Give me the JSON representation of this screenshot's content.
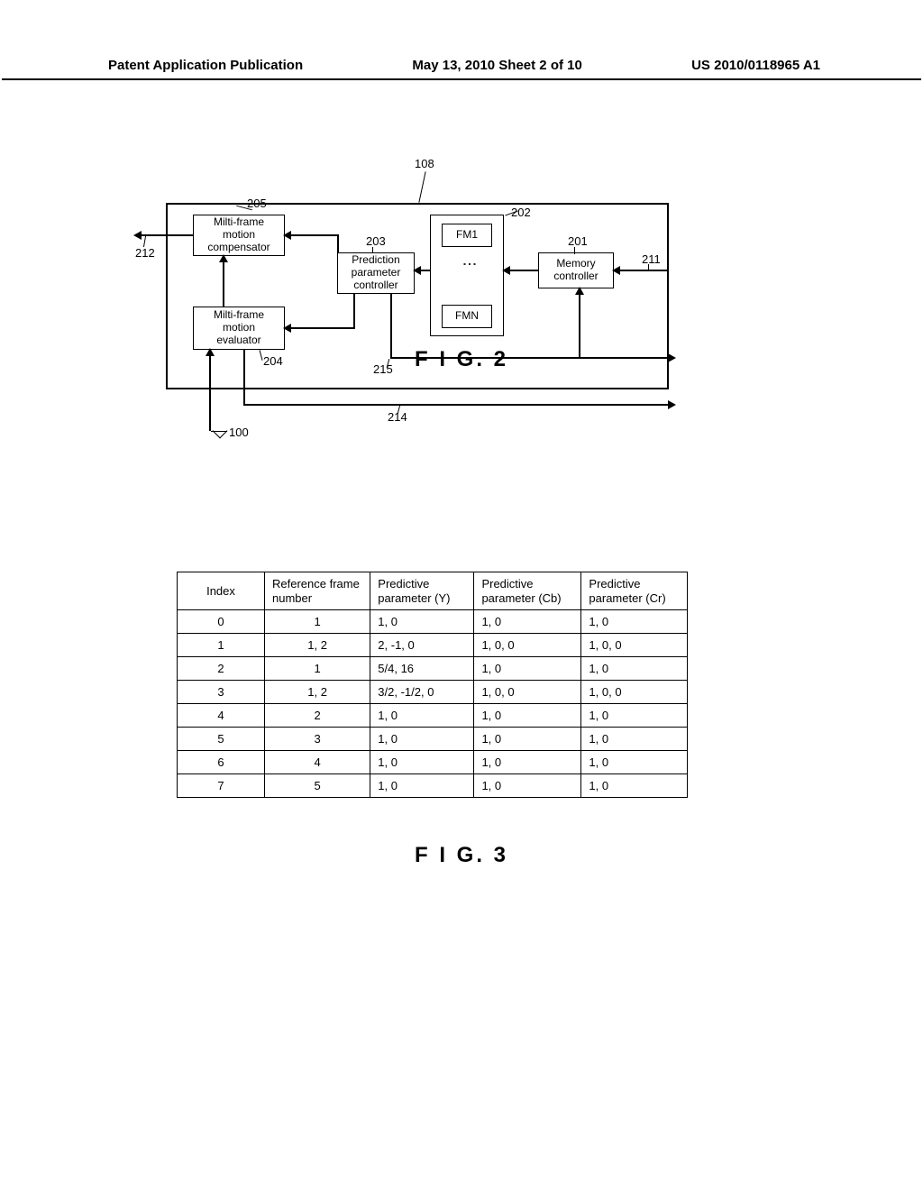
{
  "header": {
    "left": "Patent Application Publication",
    "center": "May 13, 2010   Sheet 2 of 10",
    "right": "US 2010/0118965 A1"
  },
  "fig2": {
    "caption": "F I G. 2",
    "labels": {
      "n108": "108",
      "n205": "205",
      "n202": "202",
      "n212": "212",
      "n203": "203",
      "n201": "201",
      "n211": "211",
      "n204": "204",
      "n215": "215",
      "n214": "214",
      "n100": "100"
    },
    "blocks": {
      "compensator": "Milti-frame\nmotion\ncompensator",
      "evaluator": "Milti-frame\nmotion\nevaluator",
      "predparam": "Prediction\nparameter\ncontroller",
      "memctrl": "Memory\ncontroller",
      "fm1": "FM1",
      "fmn": "FMN"
    }
  },
  "fig3": {
    "caption": "F I G. 3",
    "headers": [
      "Index",
      "Reference frame number",
      "Predictive parameter (Y)",
      "Predictive parameter (Cb)",
      "Predictive parameter (Cr)"
    ],
    "rows": [
      [
        "0",
        "1",
        "1, 0",
        "1, 0",
        "1, 0"
      ],
      [
        "1",
        "1, 2",
        "2, -1, 0",
        "1, 0, 0",
        "1, 0, 0"
      ],
      [
        "2",
        "1",
        "5/4, 16",
        "1, 0",
        "1, 0"
      ],
      [
        "3",
        "1, 2",
        "3/2, -1/2, 0",
        "1, 0, 0",
        "1, 0, 0"
      ],
      [
        "4",
        "2",
        "1, 0",
        "1, 0",
        "1, 0"
      ],
      [
        "5",
        "3",
        "1, 0",
        "1, 0",
        "1, 0"
      ],
      [
        "6",
        "4",
        "1, 0",
        "1, 0",
        "1, 0"
      ],
      [
        "7",
        "5",
        "1, 0",
        "1, 0",
        "1, 0"
      ]
    ]
  }
}
